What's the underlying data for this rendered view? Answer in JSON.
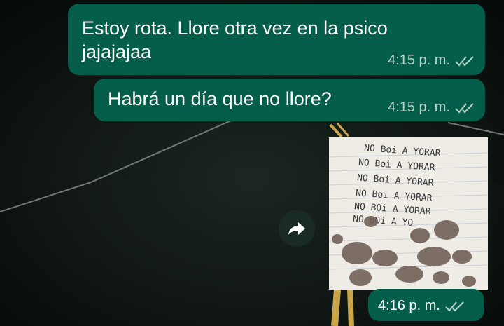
{
  "messages": [
    {
      "text_line1": "Estoy rota. Llore otra vez en la psico",
      "text_line2": "jajajajaa",
      "time": "4:15 p. m."
    },
    {
      "text": "Habrá un día que no llore?",
      "time": "4:15 p. m."
    }
  ],
  "image_message": {
    "handwriting": [
      "NO Boi A YORAR",
      "NO Boi A YORAR",
      "NO Boi A YORAR",
      "NO Boi A YORAR",
      "NO BOi A YORAR",
      "NO BOi A YO"
    ],
    "time": "4:16 p. m."
  },
  "colors": {
    "bubble": "#055e49",
    "meta_text": "#b8d4cb",
    "read_ticks": "#b8d4cb"
  },
  "icons": {
    "forward": "forward-arrow-icon",
    "read_receipt": "double-check-icon"
  }
}
